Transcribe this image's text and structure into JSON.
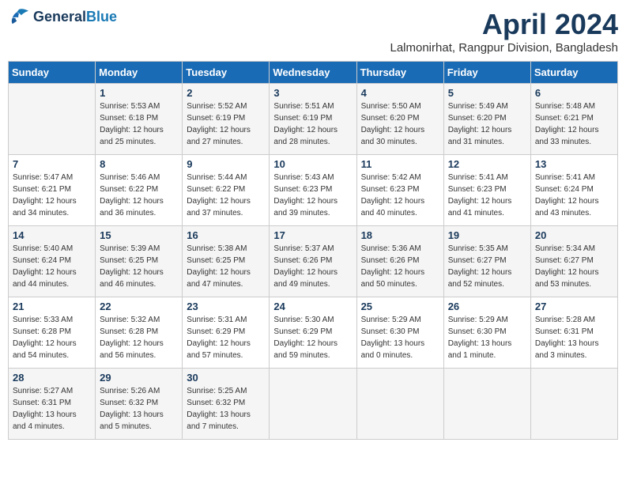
{
  "logo": {
    "line1": "General",
    "line2": "Blue"
  },
  "title": "April 2024",
  "subtitle": "Lalmonirhat, Rangpur Division, Bangladesh",
  "weekdays": [
    "Sunday",
    "Monday",
    "Tuesday",
    "Wednesday",
    "Thursday",
    "Friday",
    "Saturday"
  ],
  "weeks": [
    [
      {
        "day": "",
        "info": ""
      },
      {
        "day": "1",
        "info": "Sunrise: 5:53 AM\nSunset: 6:18 PM\nDaylight: 12 hours\nand 25 minutes."
      },
      {
        "day": "2",
        "info": "Sunrise: 5:52 AM\nSunset: 6:19 PM\nDaylight: 12 hours\nand 27 minutes."
      },
      {
        "day": "3",
        "info": "Sunrise: 5:51 AM\nSunset: 6:19 PM\nDaylight: 12 hours\nand 28 minutes."
      },
      {
        "day": "4",
        "info": "Sunrise: 5:50 AM\nSunset: 6:20 PM\nDaylight: 12 hours\nand 30 minutes."
      },
      {
        "day": "5",
        "info": "Sunrise: 5:49 AM\nSunset: 6:20 PM\nDaylight: 12 hours\nand 31 minutes."
      },
      {
        "day": "6",
        "info": "Sunrise: 5:48 AM\nSunset: 6:21 PM\nDaylight: 12 hours\nand 33 minutes."
      }
    ],
    [
      {
        "day": "7",
        "info": "Sunrise: 5:47 AM\nSunset: 6:21 PM\nDaylight: 12 hours\nand 34 minutes."
      },
      {
        "day": "8",
        "info": "Sunrise: 5:46 AM\nSunset: 6:22 PM\nDaylight: 12 hours\nand 36 minutes."
      },
      {
        "day": "9",
        "info": "Sunrise: 5:44 AM\nSunset: 6:22 PM\nDaylight: 12 hours\nand 37 minutes."
      },
      {
        "day": "10",
        "info": "Sunrise: 5:43 AM\nSunset: 6:23 PM\nDaylight: 12 hours\nand 39 minutes."
      },
      {
        "day": "11",
        "info": "Sunrise: 5:42 AM\nSunset: 6:23 PM\nDaylight: 12 hours\nand 40 minutes."
      },
      {
        "day": "12",
        "info": "Sunrise: 5:41 AM\nSunset: 6:23 PM\nDaylight: 12 hours\nand 41 minutes."
      },
      {
        "day": "13",
        "info": "Sunrise: 5:41 AM\nSunset: 6:24 PM\nDaylight: 12 hours\nand 43 minutes."
      }
    ],
    [
      {
        "day": "14",
        "info": "Sunrise: 5:40 AM\nSunset: 6:24 PM\nDaylight: 12 hours\nand 44 minutes."
      },
      {
        "day": "15",
        "info": "Sunrise: 5:39 AM\nSunset: 6:25 PM\nDaylight: 12 hours\nand 46 minutes."
      },
      {
        "day": "16",
        "info": "Sunrise: 5:38 AM\nSunset: 6:25 PM\nDaylight: 12 hours\nand 47 minutes."
      },
      {
        "day": "17",
        "info": "Sunrise: 5:37 AM\nSunset: 6:26 PM\nDaylight: 12 hours\nand 49 minutes."
      },
      {
        "day": "18",
        "info": "Sunrise: 5:36 AM\nSunset: 6:26 PM\nDaylight: 12 hours\nand 50 minutes."
      },
      {
        "day": "19",
        "info": "Sunrise: 5:35 AM\nSunset: 6:27 PM\nDaylight: 12 hours\nand 52 minutes."
      },
      {
        "day": "20",
        "info": "Sunrise: 5:34 AM\nSunset: 6:27 PM\nDaylight: 12 hours\nand 53 minutes."
      }
    ],
    [
      {
        "day": "21",
        "info": "Sunrise: 5:33 AM\nSunset: 6:28 PM\nDaylight: 12 hours\nand 54 minutes."
      },
      {
        "day": "22",
        "info": "Sunrise: 5:32 AM\nSunset: 6:28 PM\nDaylight: 12 hours\nand 56 minutes."
      },
      {
        "day": "23",
        "info": "Sunrise: 5:31 AM\nSunset: 6:29 PM\nDaylight: 12 hours\nand 57 minutes."
      },
      {
        "day": "24",
        "info": "Sunrise: 5:30 AM\nSunset: 6:29 PM\nDaylight: 12 hours\nand 59 minutes."
      },
      {
        "day": "25",
        "info": "Sunrise: 5:29 AM\nSunset: 6:30 PM\nDaylight: 13 hours\nand 0 minutes."
      },
      {
        "day": "26",
        "info": "Sunrise: 5:29 AM\nSunset: 6:30 PM\nDaylight: 13 hours\nand 1 minute."
      },
      {
        "day": "27",
        "info": "Sunrise: 5:28 AM\nSunset: 6:31 PM\nDaylight: 13 hours\nand 3 minutes."
      }
    ],
    [
      {
        "day": "28",
        "info": "Sunrise: 5:27 AM\nSunset: 6:31 PM\nDaylight: 13 hours\nand 4 minutes."
      },
      {
        "day": "29",
        "info": "Sunrise: 5:26 AM\nSunset: 6:32 PM\nDaylight: 13 hours\nand 5 minutes."
      },
      {
        "day": "30",
        "info": "Sunrise: 5:25 AM\nSunset: 6:32 PM\nDaylight: 13 hours\nand 7 minutes."
      },
      {
        "day": "",
        "info": ""
      },
      {
        "day": "",
        "info": ""
      },
      {
        "day": "",
        "info": ""
      },
      {
        "day": "",
        "info": ""
      }
    ]
  ]
}
